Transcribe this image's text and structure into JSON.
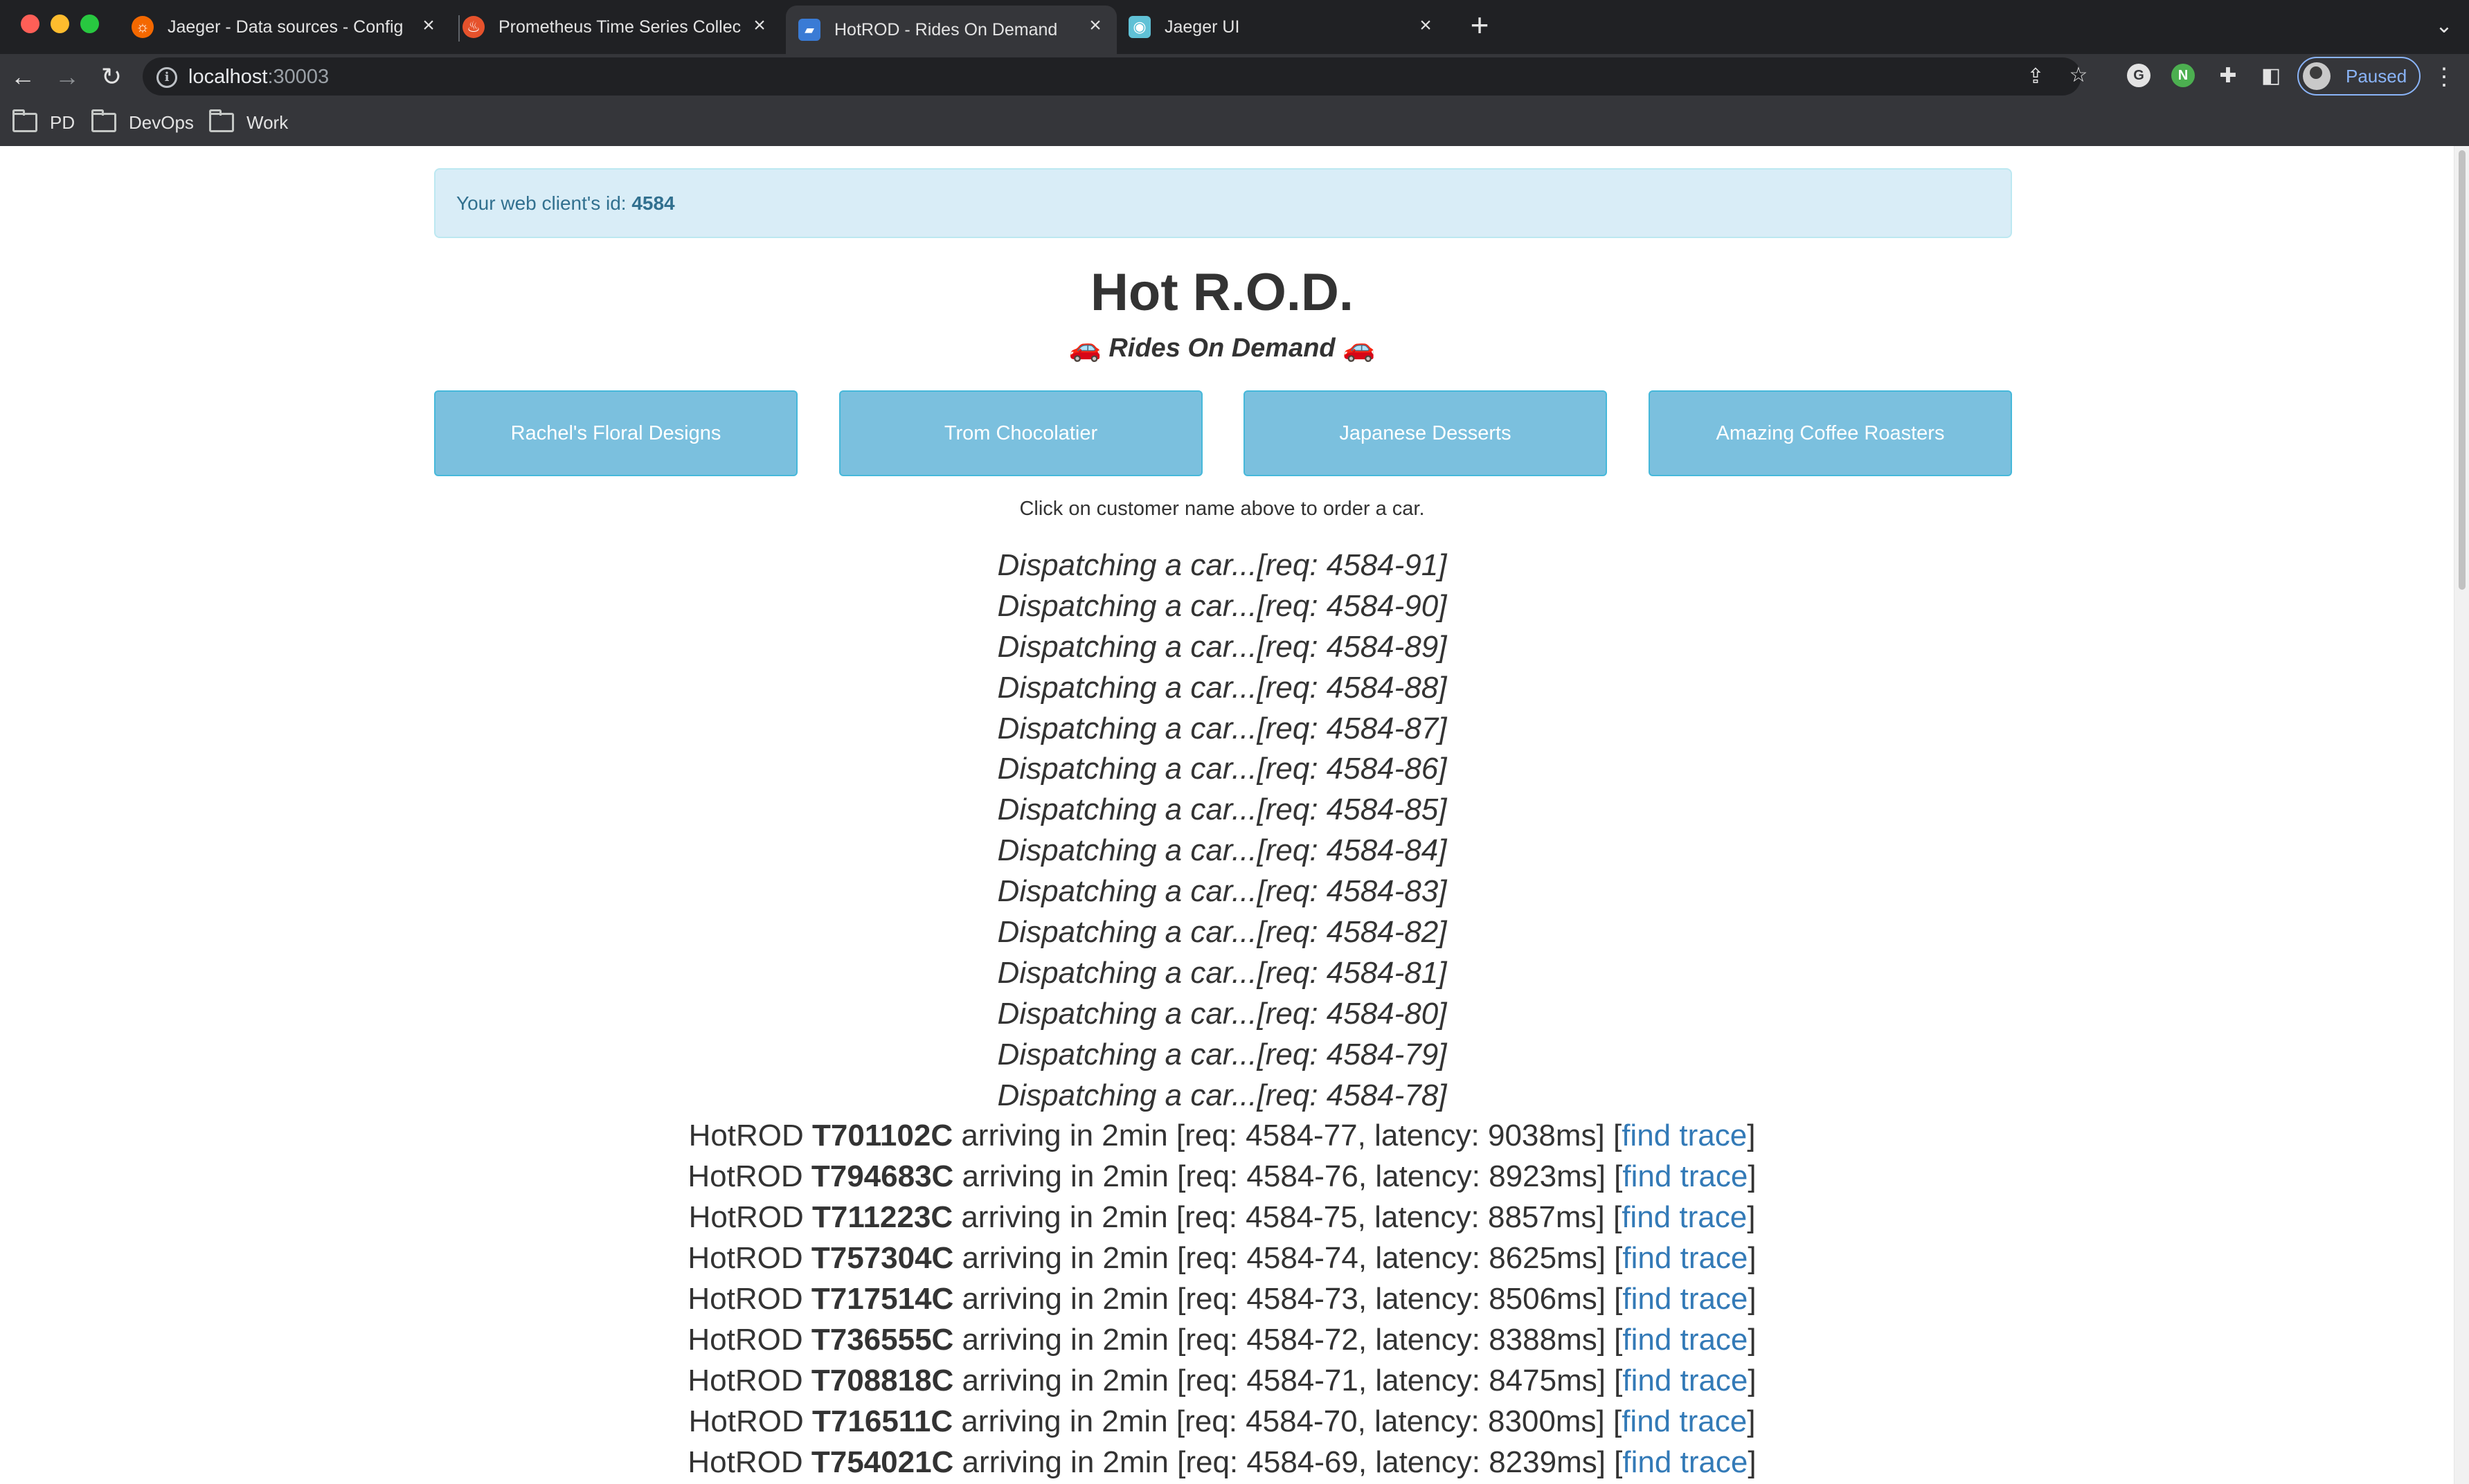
{
  "browser": {
    "tabs": [
      {
        "title": "Jaeger - Data sources - Config",
        "icon": "grafana-icon",
        "active": false
      },
      {
        "title": "Prometheus Time Series Collec",
        "icon": "prometheus-icon",
        "active": false
      },
      {
        "title": "HotROD - Rides On Demand",
        "icon": "hotrod-icon",
        "active": true
      },
      {
        "title": "Jaeger UI",
        "icon": "jaeger-icon",
        "active": false
      }
    ],
    "url_host": "localhost",
    "url_port": ":30003",
    "profile_label": "Paused",
    "bookmarks": [
      "PD",
      "DevOps",
      "Work"
    ]
  },
  "page": {
    "client_id_label": "Your web client's id: ",
    "client_id": "4584",
    "title": "Hot R.O.D.",
    "subtitle": "Rides On Demand",
    "customers": [
      "Rachel's Floral Designs",
      "Trom Chocolatier",
      "Japanese Desserts",
      "Amazing Coffee Roasters"
    ],
    "hint": "Click on customer name above to order a car.",
    "dispatching": [
      "Dispatching a car...[req: 4584-91]",
      "Dispatching a car...[req: 4584-90]",
      "Dispatching a car...[req: 4584-89]",
      "Dispatching a car...[req: 4584-88]",
      "Dispatching a car...[req: 4584-87]",
      "Dispatching a car...[req: 4584-86]",
      "Dispatching a car...[req: 4584-85]",
      "Dispatching a car...[req: 4584-84]",
      "Dispatching a car...[req: 4584-83]",
      "Dispatching a car...[req: 4584-82]",
      "Dispatching a car...[req: 4584-81]",
      "Dispatching a car...[req: 4584-80]",
      "Dispatching a car...[req: 4584-79]",
      "Dispatching a car...[req: 4584-78]"
    ],
    "arrivals": [
      {
        "car": "T701102C",
        "req": "4584-77",
        "latency": "9038ms"
      },
      {
        "car": "T794683C",
        "req": "4584-76",
        "latency": "8923ms"
      },
      {
        "car": "T711223C",
        "req": "4584-75",
        "latency": "8857ms"
      },
      {
        "car": "T757304C",
        "req": "4584-74",
        "latency": "8625ms"
      },
      {
        "car": "T717514C",
        "req": "4584-73",
        "latency": "8506ms"
      },
      {
        "car": "T736555C",
        "req": "4584-72",
        "latency": "8388ms"
      },
      {
        "car": "T708818C",
        "req": "4584-71",
        "latency": "8475ms"
      },
      {
        "car": "T716511C",
        "req": "4584-70",
        "latency": "8300ms"
      },
      {
        "car": "T754021C",
        "req": "4584-69",
        "latency": "8239ms"
      }
    ],
    "arrival_prefix": "HotROD ",
    "arrival_eta": " arriving in 2min [req: ",
    "arrival_latency_label": ", latency: ",
    "arrival_open": "] [",
    "find_trace": "find trace",
    "arrival_close": "]"
  },
  "colors": {
    "accent_button": "#7bc0de",
    "link": "#337ab7",
    "alert_bg": "#d9edf7",
    "alert_text": "#31708f"
  }
}
